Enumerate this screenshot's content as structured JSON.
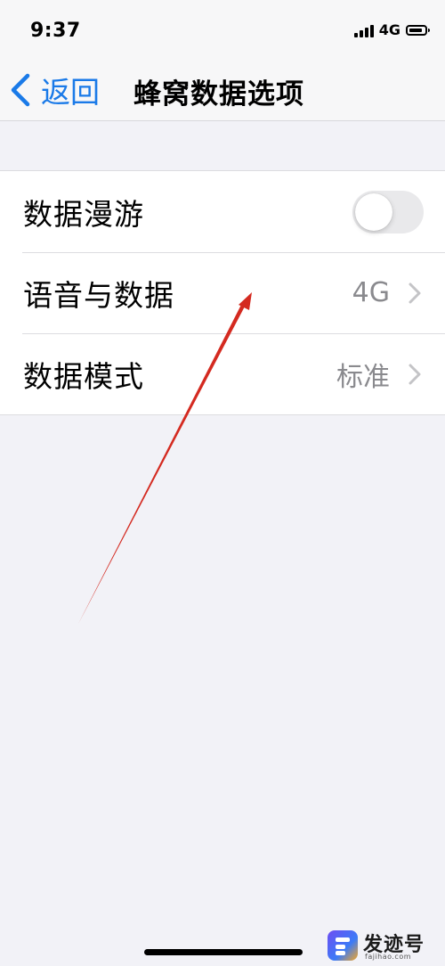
{
  "status_bar": {
    "time": "9:37",
    "network": "4G",
    "icons": [
      "signal-icon",
      "battery-icon"
    ]
  },
  "nav": {
    "back_label": "返回",
    "title": "蜂窝数据选项",
    "accent_color": "#1a7ae8"
  },
  "settings": {
    "roaming": {
      "label": "数据漫游",
      "toggle_on": false
    },
    "voice_data": {
      "label": "语音与数据",
      "value": "4G"
    },
    "data_mode": {
      "label": "数据模式",
      "value": "标准"
    }
  },
  "annotation": {
    "color": "#d42a20"
  },
  "watermark": {
    "name": "发迹号",
    "url": "fajihao.com"
  }
}
